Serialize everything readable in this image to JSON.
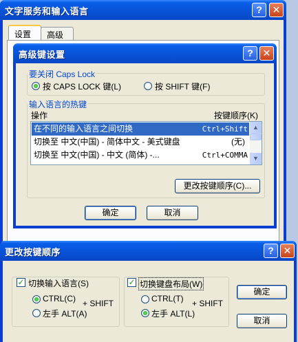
{
  "main_window": {
    "title": "文字服务和输入语言",
    "tabs": [
      "设置",
      "高级"
    ]
  },
  "advanced_dialog": {
    "title": "高级键设置",
    "caps_group": "要关闭 Caps Lock",
    "radio_caps": "按 CAPS LOCK 键(L)",
    "radio_shift": "按 SHIFT 键(F)",
    "hotkey_group": "输入语言的热键",
    "col_action": "操作",
    "col_sequence": "按键顺序(K)",
    "rows": [
      {
        "action": "在不同的输入语言之间切换",
        "keys": "Ctrl+Shift"
      },
      {
        "action": "切换至 中文(中国) - 简体中文 - 美式键盘",
        "keys": "(无)"
      },
      {
        "action": "切换至 中文(中国) - 中文 (简体) -...",
        "keys": "Ctrl+COMMA"
      }
    ],
    "change_button": "更改按键顺序(C)...",
    "ok": "确定",
    "cancel": "取消"
  },
  "change_dialog": {
    "title": "更改按键顺序",
    "switch_lang": "切换输入语言(S)",
    "switch_layout": "切换键盘布局(W)",
    "ctrl_left": "CTRL(C)",
    "ctrl_right": "CTRL(T)",
    "plus_shift": "+ SHIFT",
    "alt_left": "左手 ALT(A)",
    "alt_right": "左手 ALT(L)",
    "ok": "确定",
    "cancel": "取消"
  },
  "colors": {
    "title_blue": "#0853d8",
    "dialog_face": "#ece9d8",
    "selection": "#316ac5",
    "group_label": "#0046d5"
  }
}
